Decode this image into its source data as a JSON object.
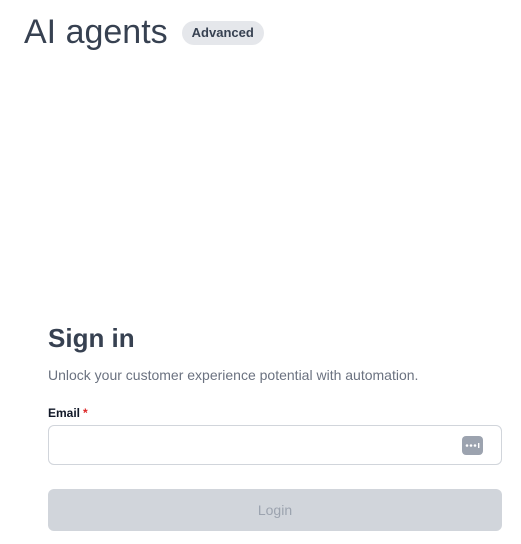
{
  "header": {
    "title": "AI agents",
    "badge": "Advanced"
  },
  "signin": {
    "title": "Sign in",
    "subtitle": "Unlock your customer experience potential with automation.",
    "email_label": "Email",
    "required_mark": "*",
    "email_value": "",
    "email_placeholder": "",
    "password_manager_icon": "password-manager-icon",
    "login_label": "Login"
  },
  "colors": {
    "text_primary": "#374151",
    "badge_bg": "#e5e7eb",
    "required": "#dc2626",
    "button_disabled_bg": "#d1d5db",
    "button_disabled_text": "#9ca3af"
  }
}
